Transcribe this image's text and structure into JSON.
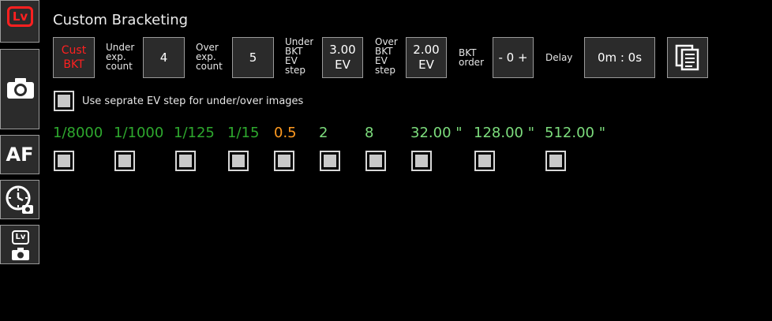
{
  "colors": {
    "accent_red": "#ff2020",
    "shutter_dark": "#2ea82e",
    "shutter_light": "#7ddd7d",
    "shutter_mid": "#ff9a20"
  },
  "sidebar": [
    {
      "name": "lv-tab",
      "icon": "liveview-icon",
      "label": "Lv"
    },
    {
      "name": "shoot-tab",
      "icon": "camera-icon"
    },
    {
      "name": "af-tab",
      "icon": "af-icon",
      "label": "AF"
    },
    {
      "name": "timelapse-tab",
      "icon": "clock-timer-icon"
    },
    {
      "name": "lv-camera-tab",
      "icon": "liveview-camera-icon",
      "label": "Lv"
    }
  ],
  "page": {
    "title": "Custom Bracketing"
  },
  "controls": {
    "mode": "Cust\nBKT",
    "under_count_label": "Under\nexp.\ncount",
    "under_count_value": "4",
    "over_count_label": "Over\nexp.\ncount",
    "over_count_value": "5",
    "under_step_label": "Under\nBKT\nEV\nstep",
    "under_step_value": "3.00\nEV",
    "over_step_label": "Over\nBKT\nEV\nstep",
    "over_step_value": "2.00\nEV",
    "order_label": "BKT\norder",
    "order_value": "- 0 +",
    "delay_label": "Delay",
    "delay_value": "0m : 0s"
  },
  "separate_step": {
    "label": "Use seprate EV step for under/over images"
  },
  "shutters": [
    {
      "value": "1/8000",
      "color": "#2ea82e"
    },
    {
      "value": "1/1000",
      "color": "#2ea82e"
    },
    {
      "value": "1/125",
      "color": "#2ea82e"
    },
    {
      "value": "1/15",
      "color": "#2ea82e"
    },
    {
      "value": "0.5",
      "color": "#ff9a20"
    },
    {
      "value": "2",
      "color": "#7ddd7d"
    },
    {
      "value": "8",
      "color": "#7ddd7d"
    },
    {
      "value": "32.00 \"",
      "color": "#7ddd7d"
    },
    {
      "value": "128.00 \"",
      "color": "#7ddd7d"
    },
    {
      "value": "512.00 \"",
      "color": "#7ddd7d"
    }
  ]
}
